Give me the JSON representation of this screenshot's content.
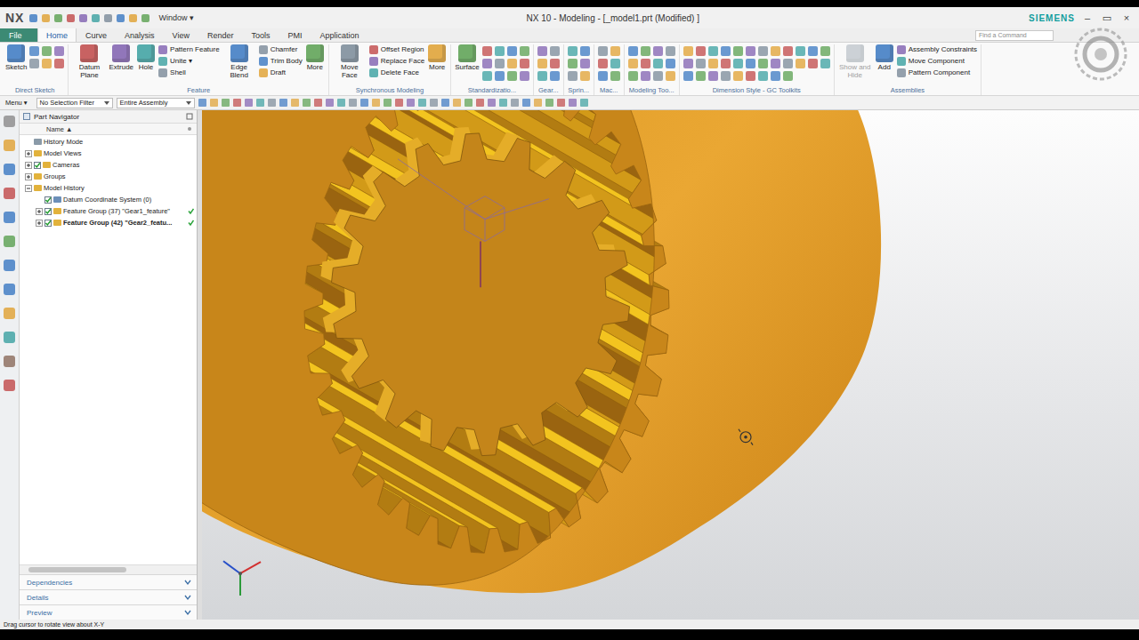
{
  "window": {
    "app_logo": "NX",
    "title": "NX 10 - Modeling - [_model1.prt (Modified) ]",
    "window_menu": "Window ▾",
    "brand": "SIEMENS",
    "controls": [
      "–",
      "▭",
      "×"
    ]
  },
  "ribbon_tabs": [
    {
      "label": "File",
      "selected": false,
      "kind": "file"
    },
    {
      "label": "Home",
      "selected": true,
      "kind": "tab"
    },
    {
      "label": "Curve",
      "selected": false,
      "kind": "tab"
    },
    {
      "label": "Analysis",
      "selected": false,
      "kind": "tab"
    },
    {
      "label": "View",
      "selected": false,
      "kind": "tab"
    },
    {
      "label": "Render",
      "selected": false,
      "kind": "tab"
    },
    {
      "label": "Tools",
      "selected": false,
      "kind": "tab"
    },
    {
      "label": "PMI",
      "selected": false,
      "kind": "tab"
    },
    {
      "label": "Application",
      "selected": false,
      "kind": "tab"
    }
  ],
  "search": {
    "placeholder": "Find a Command"
  },
  "ribbon_groups": [
    {
      "label": "Direct Sketch",
      "items": [
        {
          "kind": "large",
          "label": "Sketch",
          "disabled": false
        },
        {
          "kind": "icons"
        }
      ]
    },
    {
      "label": "Feature",
      "items": [
        {
          "kind": "large",
          "label": "Datum Plane",
          "disabled": false
        },
        {
          "kind": "large",
          "label": "Extrude",
          "disabled": false
        },
        {
          "kind": "large",
          "label": "Hole",
          "disabled": false
        },
        {
          "kind": "stack",
          "labels": [
            "Pattern Feature",
            "Unite ▾",
            "Shell"
          ]
        },
        {
          "kind": "large",
          "label": "Edge Blend",
          "disabled": false
        },
        {
          "kind": "stack",
          "labels": [
            "Chamfer",
            "Trim Body",
            "Draft"
          ]
        },
        {
          "kind": "large",
          "label": "More",
          "disabled": false
        }
      ]
    },
    {
      "label": "Synchronous Modeling",
      "items": [
        {
          "kind": "large",
          "label": "Move Face",
          "disabled": false
        },
        {
          "kind": "stack",
          "labels": [
            "Offset Region",
            "Replace Face",
            "Delete Face"
          ]
        },
        {
          "kind": "large",
          "label": "More",
          "disabled": false
        }
      ]
    },
    {
      "label": "Standardizatio...",
      "items": [
        {
          "kind": "large",
          "label": "Surface",
          "disabled": false
        },
        {
          "kind": "icons"
        }
      ]
    },
    {
      "label": "Gear...",
      "items": [
        {
          "kind": "icons"
        }
      ]
    },
    {
      "label": "Sprin...",
      "items": [
        {
          "kind": "icons"
        }
      ]
    },
    {
      "label": "Mac...",
      "items": [
        {
          "kind": "icons"
        }
      ]
    },
    {
      "label": "Modeling Too...",
      "items": [
        {
          "kind": "icons"
        }
      ]
    },
    {
      "label": "Dimension Style - GC Toolkits",
      "items": [
        {
          "kind": "icons"
        }
      ]
    },
    {
      "label": "Assemblies",
      "items": [
        {
          "kind": "large",
          "label": "Show and Hide",
          "disabled": true
        },
        {
          "kind": "large",
          "label": "Add",
          "disabled": false
        },
        {
          "kind": "stack",
          "labels": [
            "Assembly Constraints",
            "Move Component",
            "Pattern Component"
          ]
        }
      ]
    }
  ],
  "toolbar": {
    "menu": "Menu ▾",
    "selection_filter": "No Selection Filter",
    "scope": "Entire Assembly"
  },
  "navigator": {
    "title": "Part Navigator",
    "column": "Name ▲",
    "tree": [
      {
        "label": "History Mode",
        "has_children": false,
        "expanded": false,
        "has_checkbox": false,
        "checked": false,
        "current": false,
        "status_mark": false,
        "children": []
      },
      {
        "label": "Model Views",
        "has_children": true,
        "expanded": false,
        "has_checkbox": false,
        "checked": false,
        "current": false,
        "status_mark": false,
        "children": []
      },
      {
        "label": "Cameras",
        "has_children": true,
        "expanded": false,
        "has_checkbox": true,
        "checked": true,
        "current": false,
        "status_mark": false,
        "children": []
      },
      {
        "label": "Groups",
        "has_children": true,
        "expanded": false,
        "has_checkbox": false,
        "checked": false,
        "current": false,
        "status_mark": false,
        "children": []
      },
      {
        "label": "Model History",
        "has_children": true,
        "expanded": true,
        "has_checkbox": false,
        "checked": false,
        "current": false,
        "status_mark": false,
        "children": [
          {
            "label": "Datum Coordinate System (0)",
            "has_children": false,
            "expanded": false,
            "has_checkbox": true,
            "checked": true,
            "current": false,
            "status_mark": false,
            "children": []
          },
          {
            "label": "Feature Group (37) \"Gear1_feature\"",
            "has_children": true,
            "expanded": false,
            "has_checkbox": true,
            "checked": true,
            "current": false,
            "status_mark": true,
            "children": []
          },
          {
            "label": "Feature Group (42) \"Gear2_featu...",
            "has_children": true,
            "expanded": false,
            "has_checkbox": true,
            "checked": true,
            "current": true,
            "status_mark": true,
            "children": []
          }
        ]
      }
    ],
    "panels": [
      {
        "label": "Dependencies",
        "expanded": false
      },
      {
        "label": "Details",
        "expanded": false
      },
      {
        "label": "Preview",
        "expanded": false
      }
    ]
  },
  "status_bar": {
    "text": "Drag cursor to rotate view about X-Y"
  }
}
